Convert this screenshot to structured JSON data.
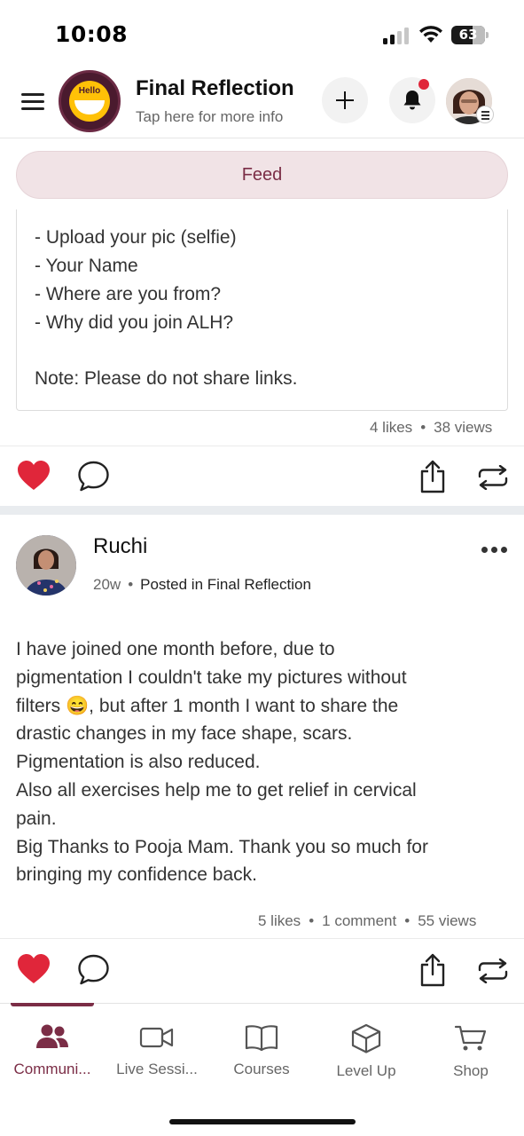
{
  "status_bar": {
    "time": "10:08",
    "battery": "63"
  },
  "header": {
    "logo_text": "Hello",
    "title": "Final Reflection",
    "subtitle": "Tap here for more info"
  },
  "feed_tab": {
    "label": "Feed"
  },
  "post1": {
    "lines": [
      "- Upload your pic (selfie)",
      "- Your Name",
      "- Where are you from?",
      "- Why did you join ALH?",
      "Note: Please do not share links."
    ],
    "likes": "4 likes",
    "views": "38 views",
    "liked": true
  },
  "post2": {
    "author": "Ruchi",
    "age": "20w",
    "posted_in": "Posted in Final Reflection",
    "body": [
      "I have joined one month before, due to",
      "pigmentation I couldn't take my pictures without",
      "filters 😄, but after 1 month I want to share the",
      "drastic changes in my face shape, scars.",
      "Pigmentation is also reduced.",
      "Also all exercises help me to get relief in cervical",
      "pain.",
      "Big Thanks to Pooja Mam. Thank you so much for",
      "bringing my confidence back."
    ],
    "likes": "5 likes",
    "comments": "1 comment",
    "views": "55 views",
    "liked": true
  },
  "bottom_nav": {
    "items": [
      {
        "label": "Communi...",
        "icon": "community-icon",
        "active": true
      },
      {
        "label": "Live Sessi...",
        "icon": "video-icon",
        "active": false
      },
      {
        "label": "Courses",
        "icon": "book-icon",
        "active": false
      },
      {
        "label": "Level Up",
        "icon": "cube-icon",
        "active": false
      },
      {
        "label": "Shop",
        "icon": "cart-icon",
        "active": false
      }
    ]
  },
  "colors": {
    "brand": "#7b2d46",
    "like_red": "#e0263a",
    "feed_pill_bg": "#f1e3e6"
  }
}
